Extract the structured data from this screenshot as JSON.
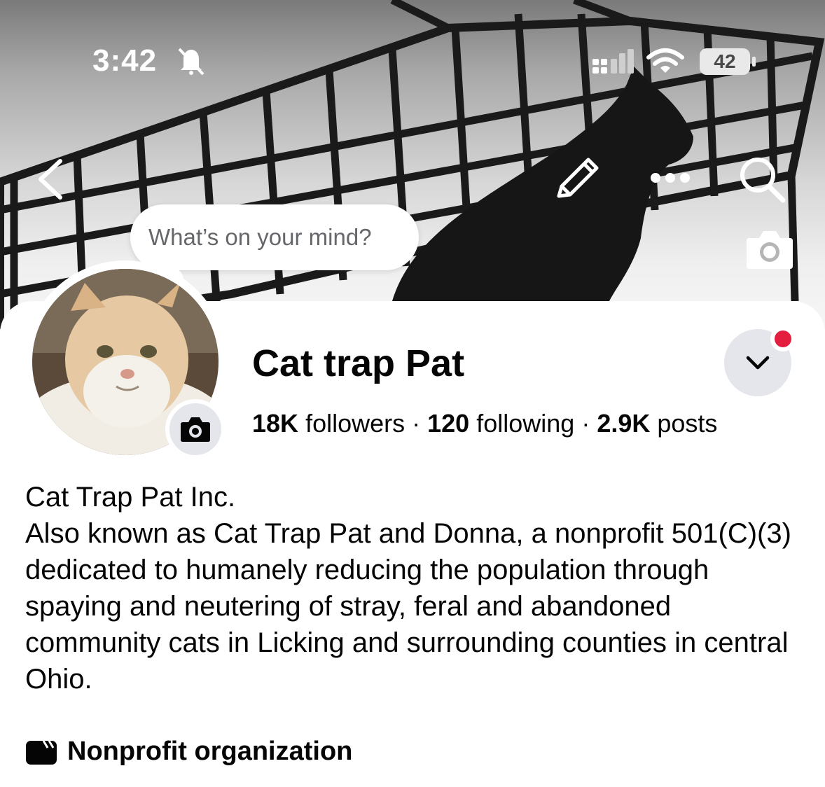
{
  "status_bar": {
    "time": "3:42",
    "battery": "42",
    "icons": [
      "bell-muted-icon",
      "signal-icon",
      "wifi-icon",
      "battery-icon"
    ]
  },
  "nav": {
    "icons": [
      "back-icon",
      "edit-icon",
      "more-icon",
      "search-icon",
      "camera-icon"
    ]
  },
  "composer": {
    "placeholder": "What’s on your mind?"
  },
  "profile": {
    "name": "Cat trap Pat",
    "followers_count": "18K",
    "followers_label": "followers",
    "following_count": "120",
    "following_label": "following",
    "posts_count": "2.9K",
    "posts_label": "posts",
    "separator": "·"
  },
  "bio": {
    "line1": "Cat Trap Pat Inc.",
    "line2": "Also known as Cat Trap Pat and Donna, a nonprofit 501(C)(3) dedicated to humanely reducing the population through spaying and neutering of stray, feral and abandoned community cats in Licking and surrounding counties in central Ohio."
  },
  "category": {
    "icon": "clapperboard-icon",
    "label": "Nonprofit organization"
  },
  "colors": {
    "notification_dot": "#e41e3f",
    "button_bg": "#e4e6eb",
    "secondary_text": "#65676b"
  }
}
